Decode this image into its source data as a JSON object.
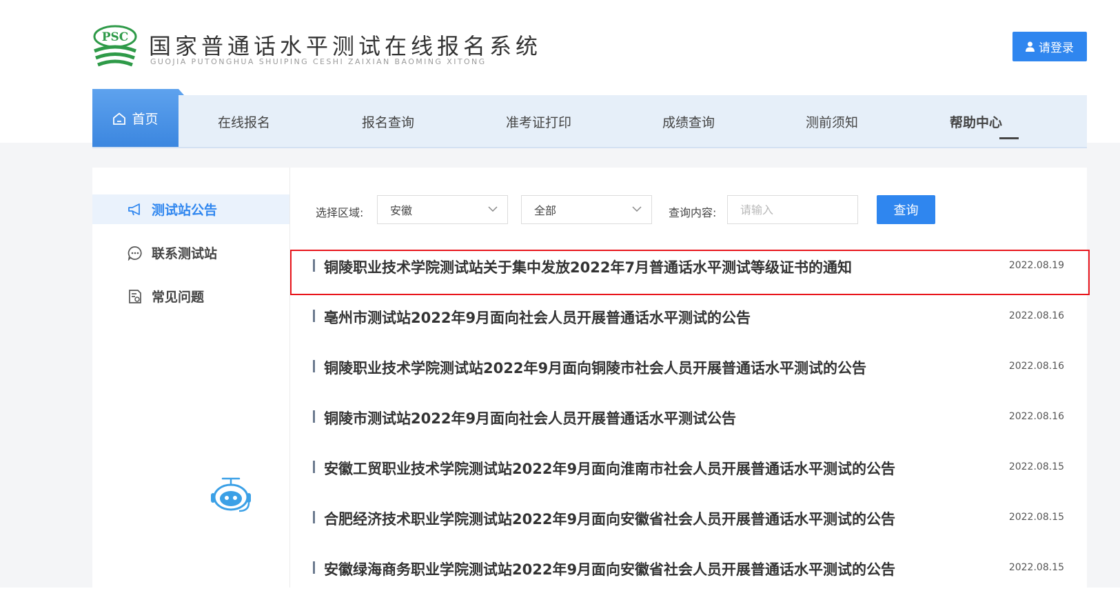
{
  "header": {
    "title": "国家普通话水平测试在线报名系统",
    "pinyin": "GUOJIA PUTONGHUA SHUIPING CESHI ZAIXIAN BAOMING XITONG",
    "logo_text": "PSC",
    "login_label": "请登录",
    "login_icon": "user-icon"
  },
  "nav": {
    "items": [
      {
        "label": "首页",
        "icon": "home-icon"
      },
      {
        "label": "在线报名"
      },
      {
        "label": "报名查询"
      },
      {
        "label": "准考证打印"
      },
      {
        "label": "成绩查询"
      },
      {
        "label": "测前须知"
      },
      {
        "label": "帮助中心"
      }
    ],
    "active": "帮助中心"
  },
  "sidebar": {
    "items": [
      {
        "label": "测试站公告",
        "icon": "megaphone-icon"
      },
      {
        "label": "联系测试站",
        "icon": "chat-icon"
      },
      {
        "label": "常见问题",
        "icon": "document-question-icon"
      }
    ],
    "active": "测试站公告"
  },
  "filters": {
    "region_label": "选择区域:",
    "region_value": "安徽",
    "scope_value": "全部",
    "query_label": "查询内容:",
    "query_placeholder": "请输入",
    "query_button": "查询"
  },
  "announcements": [
    {
      "title": "铜陵职业技术学院测试站关于集中发放2022年7月普通话水平测试等级证书的通知",
      "date": "2022.08.19"
    },
    {
      "title": "亳州市测试站2022年9月面向社会人员开展普通话水平测试的公告",
      "date": "2022.08.16"
    },
    {
      "title": "铜陵职业技术学院测试站2022年9月面向铜陵市社会人员开展普通话水平测试的公告",
      "date": "2022.08.16"
    },
    {
      "title": "铜陵市测试站2022年9月面向社会人员开展普通话水平测试公告",
      "date": "2022.08.16"
    },
    {
      "title": "安徽工贸职业技术学院测试站2022年9月面向淮南市社会人员开展普通话水平测试的公告",
      "date": "2022.08.15"
    },
    {
      "title": "合肥经济技术职业学院测试站2022年9月面向安徽省社会人员开展普通话水平测试的公告",
      "date": "2022.08.15"
    },
    {
      "title": "安徽绿海商务职业学院测试站2022年9月面向安徽省社会人员开展普通话水平测试的公告",
      "date": "2022.08.15"
    }
  ],
  "colors": {
    "accent": "#2f86ef",
    "highlight": "#e8141b",
    "logo_green": "#2e9a48"
  }
}
